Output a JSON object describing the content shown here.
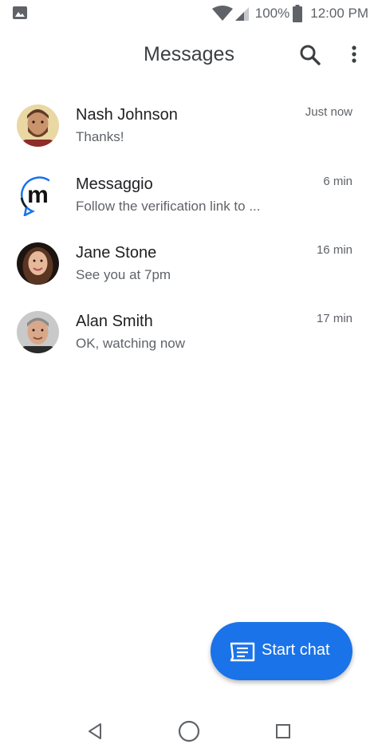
{
  "status_bar": {
    "left_icon": "image-notification-icon",
    "icons": [
      "wifi-icon",
      "cell-signal-icon"
    ],
    "battery": "100%",
    "time": "12:00 PM"
  },
  "app_bar": {
    "title": "Messages",
    "search_icon": "search-icon",
    "more_icon": "more-vert-icon"
  },
  "conversations": [
    {
      "name": "Nash Johnson",
      "snippet": "Thanks!",
      "time": "Just now",
      "avatar": "photo"
    },
    {
      "name": "Messaggio",
      "snippet": "Follow the verification link to ...",
      "time": "6 min",
      "avatar": "messaggio-logo"
    },
    {
      "name": "Jane Stone",
      "snippet": "See you at 7pm",
      "time": "16 min",
      "avatar": "photo"
    },
    {
      "name": "Alan Smith",
      "snippet": "OK, watching now",
      "time": "17 min",
      "avatar": "photo"
    }
  ],
  "fab": {
    "label": "Start chat",
    "icon": "message-icon"
  },
  "nav_bar": {
    "buttons": [
      "back-icon",
      "home-icon",
      "recents-icon"
    ]
  },
  "colors": {
    "accent": "#1a73e8",
    "text_primary": "#202124",
    "text_secondary": "#5f6368"
  }
}
